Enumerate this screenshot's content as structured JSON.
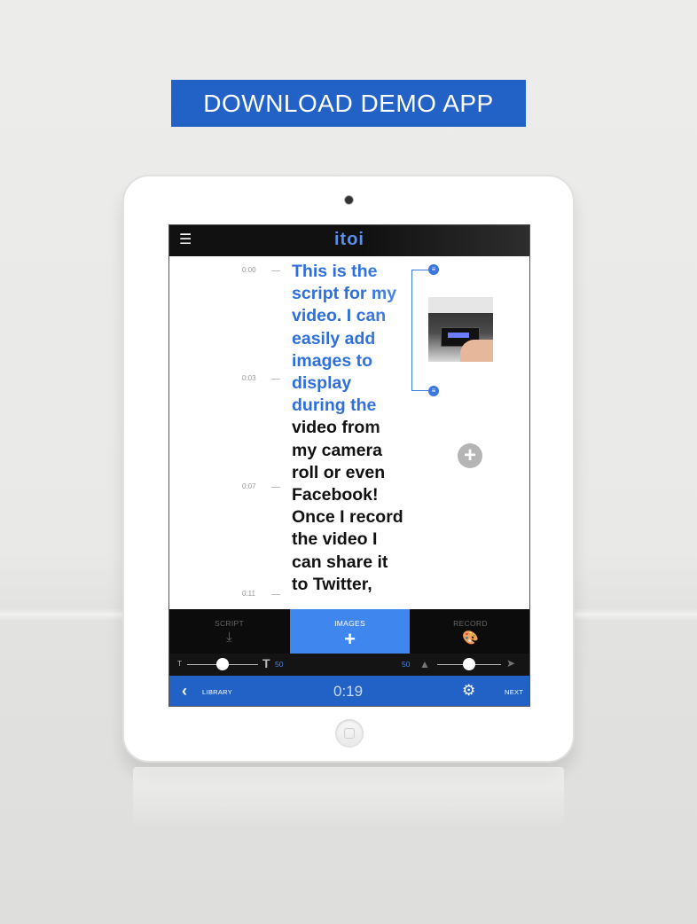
{
  "banner": {
    "label": "DOWNLOAD DEMO APP",
    "color": "#2261c6"
  },
  "app": {
    "logo": "itoi",
    "menu_icon": "hamburger-icon",
    "accent": "#3f86ee"
  },
  "script": {
    "timestamps": [
      "0:00",
      "0:03",
      "0:07",
      "0:11"
    ],
    "highlighted_text": "This is the script for my video.  I can easily add images to display during the",
    "rest_text": " video from my camera roll or even Facebook! Once I record the video I can share it to Twitter,"
  },
  "image_panel": {
    "thumbnail_icon": "photo-thumbnail",
    "add_icon": "plus-icon"
  },
  "tabs": [
    {
      "label": "SCRIPT",
      "icon": "tray-download-icon",
      "glyph": "⤓",
      "active": false
    },
    {
      "label": "IMAGES",
      "icon": "plus-icon",
      "glyph": "+",
      "active": true
    },
    {
      "label": "RECORD",
      "icon": "palette-icon",
      "glyph": "🎨",
      "active": false
    }
  ],
  "sliders": {
    "text_size": {
      "value": "50",
      "fraction": 0.5,
      "small_label": "T",
      "big_label": "T"
    },
    "speed": {
      "value": "50",
      "fraction": 0.5
    }
  },
  "bottom_bar": {
    "back_label": "LIBRARY",
    "timer": "0:19",
    "next_label": "NEXT",
    "settings_icon": "gear-icon"
  }
}
